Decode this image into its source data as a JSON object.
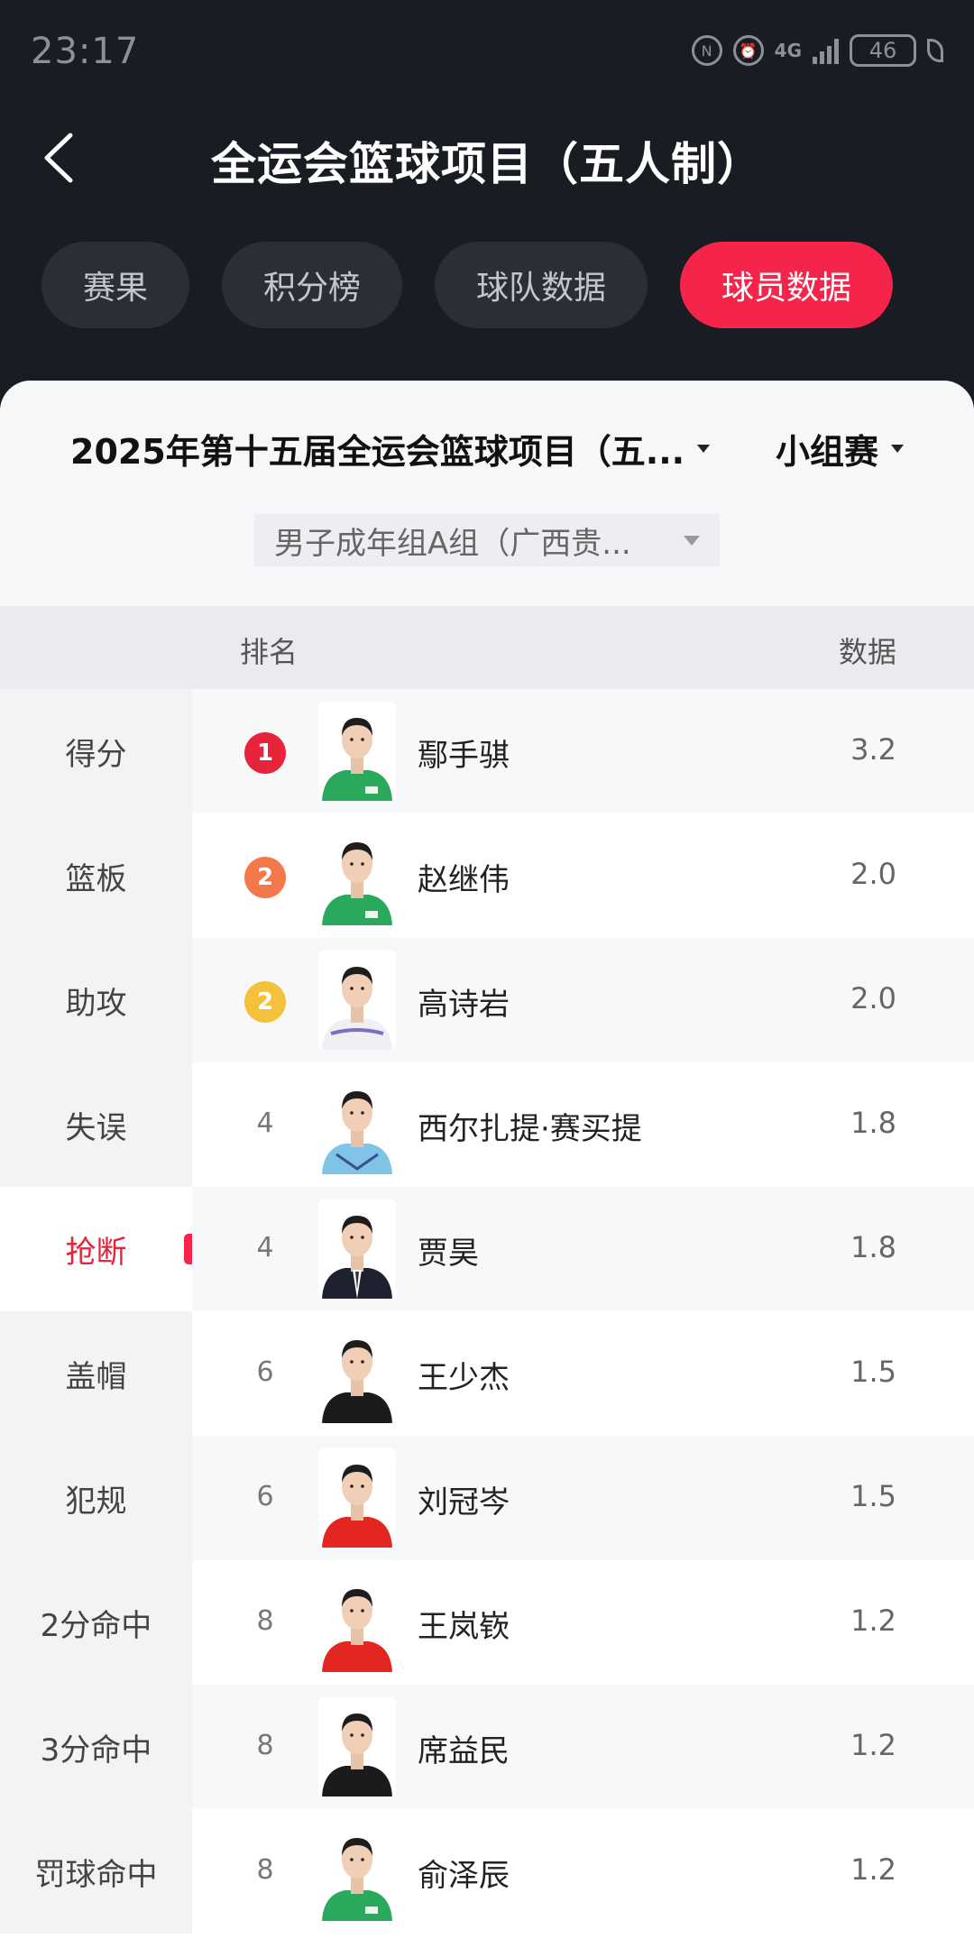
{
  "status_bar": {
    "time": "23:17",
    "network": "4G",
    "battery": "46"
  },
  "header": {
    "title": "全运会篮球项目（五人制）"
  },
  "tabs": [
    {
      "label": "赛果",
      "active": false
    },
    {
      "label": "积分榜",
      "active": false
    },
    {
      "label": "球队数据",
      "active": false
    },
    {
      "label": "球员数据",
      "active": true
    }
  ],
  "filters": {
    "season": "2025年第十五届全运会篮球项目（五...",
    "stage": "小组赛",
    "group": "男子成年组A组（广西贵..."
  },
  "table_header": {
    "rank": "排名",
    "value": "数据"
  },
  "categories": [
    {
      "label": "得分",
      "active": false
    },
    {
      "label": "篮板",
      "active": false
    },
    {
      "label": "助攻",
      "active": false
    },
    {
      "label": "失误",
      "active": false
    },
    {
      "label": "抢断",
      "active": true
    },
    {
      "label": "盖帽",
      "active": false
    },
    {
      "label": "犯规",
      "active": false
    },
    {
      "label": "2分命中",
      "active": false
    },
    {
      "label": "3分命中",
      "active": false
    },
    {
      "label": "罚球命中",
      "active": false
    }
  ],
  "players": [
    {
      "rank": "1",
      "name": "鄢手骐",
      "value": "3.2",
      "badge_color": "#e8243c",
      "jersey": "green"
    },
    {
      "rank": "2",
      "name": "赵继伟",
      "value": "2.0",
      "badge_color": "#f3794a",
      "jersey": "green"
    },
    {
      "rank": "2",
      "name": "高诗岩",
      "value": "2.0",
      "badge_color": "#f5c13b",
      "jersey": "white"
    },
    {
      "rank": "4",
      "name": "西尔扎提·赛买提",
      "value": "1.8",
      "badge_color": "",
      "jersey": "blue"
    },
    {
      "rank": "4",
      "name": "贾昊",
      "value": "1.8",
      "badge_color": "",
      "jersey": "suit"
    },
    {
      "rank": "6",
      "name": "王少杰",
      "value": "1.5",
      "badge_color": "",
      "jersey": "black"
    },
    {
      "rank": "6",
      "name": "刘冠岑",
      "value": "1.5",
      "badge_color": "",
      "jersey": "red"
    },
    {
      "rank": "8",
      "name": "王岚嵚",
      "value": "1.2",
      "badge_color": "",
      "jersey": "red"
    },
    {
      "rank": "8",
      "name": "席益民",
      "value": "1.2",
      "badge_color": "",
      "jersey": "black"
    },
    {
      "rank": "8",
      "name": "俞泽辰",
      "value": "1.2",
      "badge_color": "",
      "jersey": "green"
    }
  ]
}
